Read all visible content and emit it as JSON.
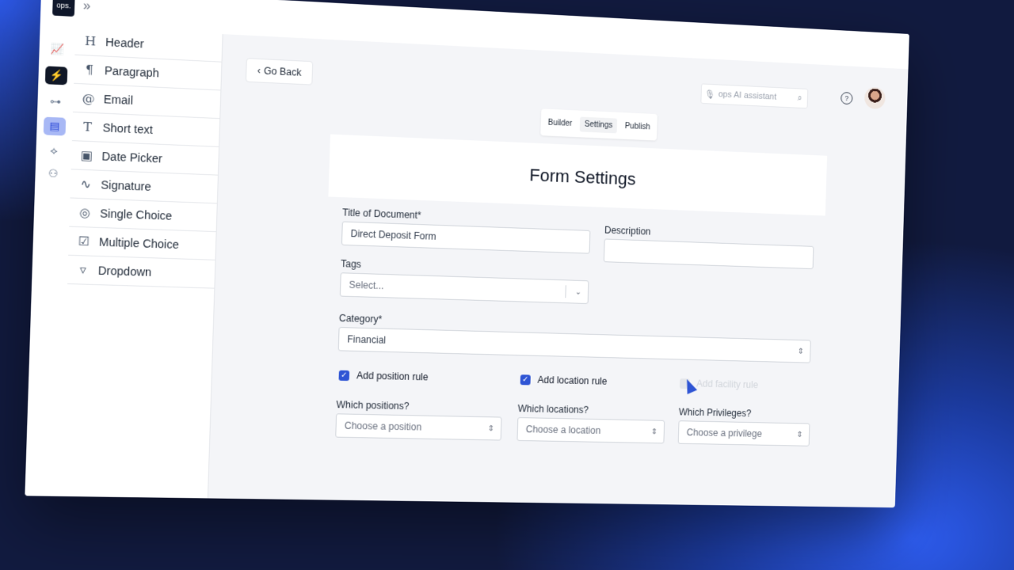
{
  "app": {
    "logo_text": "ops."
  },
  "topbar": {
    "expand_icon": "chevron-double-right-icon",
    "assistant_placeholder": "ops AI assistant",
    "help_glyph": "?"
  },
  "rail": {
    "items": [
      {
        "icon": "analytics-icon"
      },
      {
        "icon": "lightning-icon",
        "state": "dark"
      },
      {
        "icon": "org-chart-icon"
      },
      {
        "icon": "form-builder-icon",
        "state": "active"
      },
      {
        "icon": "handshake-icon"
      },
      {
        "icon": "team-icon"
      }
    ]
  },
  "components": {
    "items": [
      {
        "icon": "H",
        "label": "Header"
      },
      {
        "icon": "¶",
        "label": "Paragraph"
      },
      {
        "icon": "@",
        "label": "Email"
      },
      {
        "icon": "T",
        "label": "Short text"
      },
      {
        "icon": "▣",
        "label": "Date Picker"
      },
      {
        "icon": "∿",
        "label": "Signature"
      },
      {
        "icon": "◎",
        "label": "Single Choice"
      },
      {
        "icon": "☑",
        "label": "Multiple Choice"
      },
      {
        "icon": "▿",
        "label": "Dropdown"
      }
    ]
  },
  "nav": {
    "go_back": "Go Back"
  },
  "tabs": [
    {
      "label": "Builder",
      "active": false
    },
    {
      "label": "Settings",
      "active": true
    },
    {
      "label": "Publish",
      "active": false
    }
  ],
  "form": {
    "title": "Form Settings",
    "title_of_document": {
      "label": "Title of Document*",
      "value": "Direct Deposit Form"
    },
    "description": {
      "label": "Description",
      "value": ""
    },
    "tags": {
      "label": "Tags",
      "placeholder": "Select..."
    },
    "category": {
      "label": "Category*",
      "value": "Financial"
    },
    "rules": [
      {
        "label": "Add position rule",
        "checked": true
      },
      {
        "label": "Add location rule",
        "checked": true
      },
      {
        "label": "Add facility rule",
        "checked": false
      }
    ],
    "positions": {
      "label": "Which positions?",
      "placeholder": "Choose a position"
    },
    "locations": {
      "label": "Which locations?",
      "placeholder": "Choose a location"
    },
    "privileges": {
      "label": "Which Privileges?",
      "placeholder": "Choose a privilege"
    }
  },
  "colors": {
    "accent": "#2f55d4",
    "dark": "#111827",
    "background": "#111a3f"
  }
}
